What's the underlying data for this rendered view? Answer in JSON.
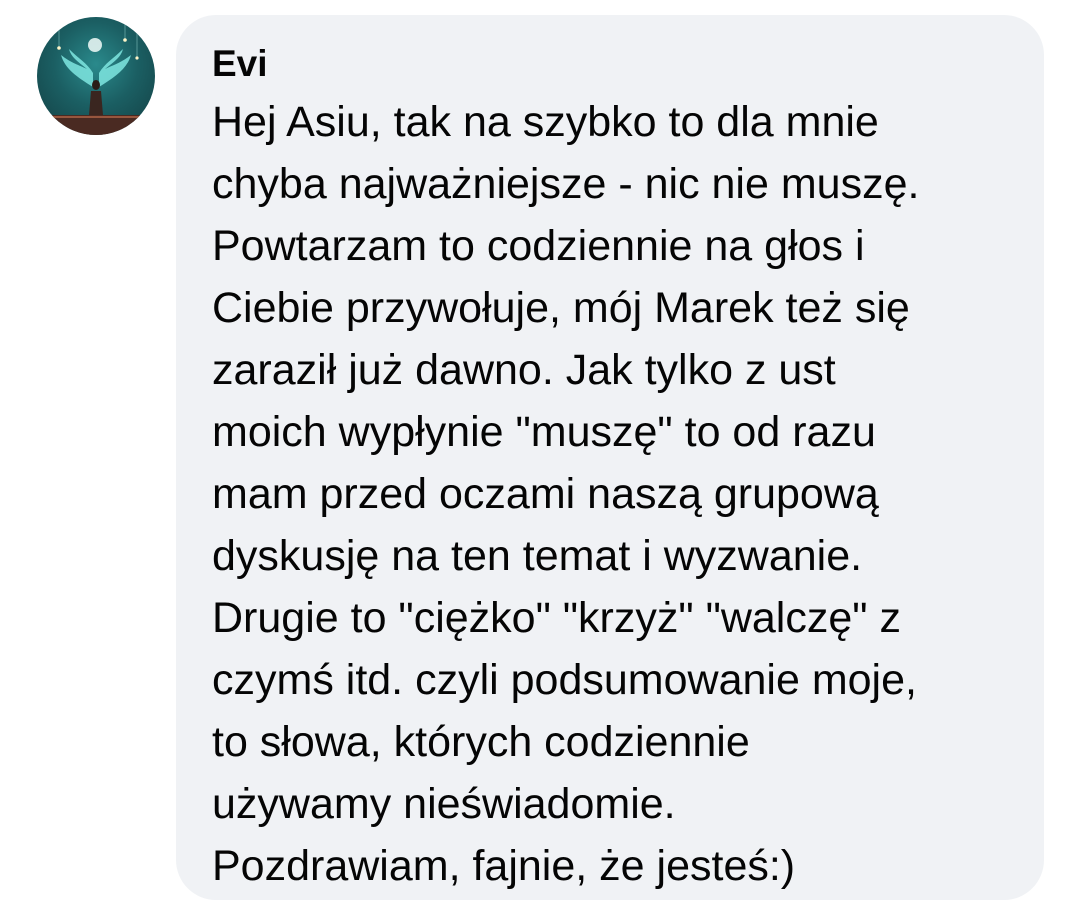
{
  "comment": {
    "author": "Evi",
    "lines": [
      "Hej Asiu, tak na szybko to dla mnie",
      "chyba najważniejsze - nic nie muszę.",
      "Powtarzam to codziennie na głos i",
      "Ciebie przywołuje, mój Marek też się",
      "zaraził już dawno. Jak tylko z ust",
      "moich wypłynie \"muszę\" to od razu",
      "mam przed oczami naszą grupową",
      "dyskusję na ten temat i wyzwanie.",
      "Drugie to \"ciężko\" \"krzyż\" \"walczę\" z",
      "czymś itd. czyli podsumowanie moje,",
      "to słowa, których codziennie",
      "używamy nieświadomie.",
      "Pozdrawiam, fajnie, że jesteś:)"
    ]
  },
  "colors": {
    "bubble_background": "#f0f2f5",
    "text": "#050505",
    "avatar_primary": "#1b5f63",
    "avatar_wings": "#7fe6e0"
  }
}
